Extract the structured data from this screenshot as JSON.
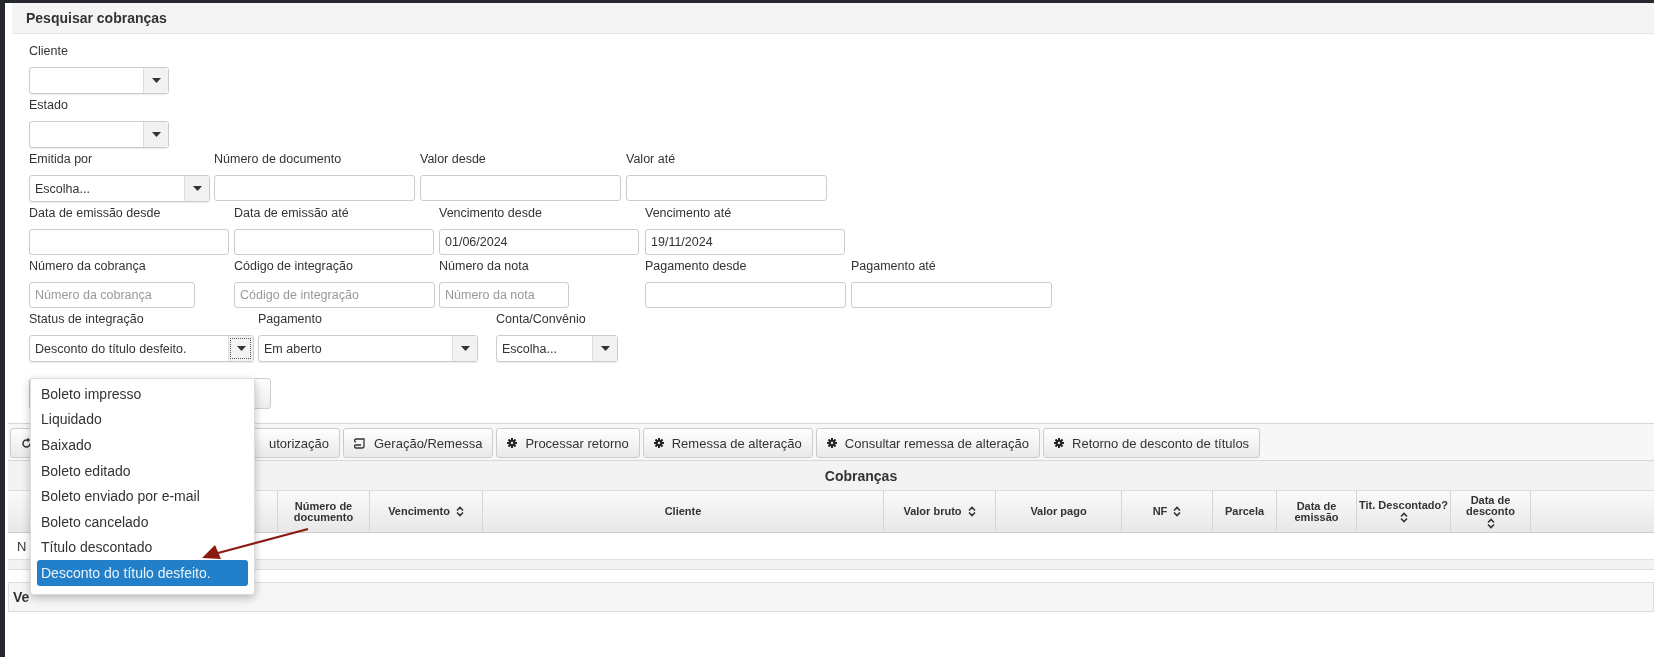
{
  "panel_title": "Pesquisar cobranças",
  "filter_rows": [
    [
      {
        "label": "Cliente",
        "kind": "select"
      }
    ],
    [
      {
        "label": "Estado",
        "kind": "select"
      }
    ],
    [
      {
        "label": "Emitida por",
        "kind": "select",
        "value": "Escolha..."
      },
      {
        "label": "Número de documento",
        "kind": "text"
      },
      {
        "label": "Valor desde",
        "kind": "text"
      },
      {
        "label": "Valor até",
        "kind": "text"
      }
    ],
    [
      {
        "label": "Data de emissão desde",
        "kind": "text"
      },
      {
        "label": "Data de emissão até",
        "kind": "text"
      },
      {
        "label": "Vencimento desde",
        "kind": "text",
        "value": "01/06/2024"
      },
      {
        "label": "Vencimento até",
        "kind": "text",
        "value": "19/11/2024"
      }
    ],
    [
      {
        "label": "Número da cobrança",
        "kind": "text",
        "placeholder": "Número da cobrança"
      },
      {
        "label": "Código de integração",
        "kind": "text",
        "placeholder": "Código de integração"
      },
      {
        "label": "Número da nota",
        "kind": "text",
        "placeholder": "Número da nota"
      },
      {
        "label": "Pagamento desde",
        "kind": "text"
      },
      {
        "label": "Pagamento até",
        "kind": "text"
      }
    ],
    [
      {
        "label": "Status de integração",
        "kind": "select",
        "value": "Desconto do título desfeito.",
        "open": true
      },
      {
        "label": "Pagamento",
        "kind": "select",
        "value": "Em aberto"
      },
      {
        "label": "Conta/Convênio",
        "kind": "select",
        "value": "Escolha..."
      }
    ]
  ],
  "status_options": [
    {
      "label": "Boleto impresso",
      "selected": false
    },
    {
      "label": "Liquidado",
      "selected": false
    },
    {
      "label": "Baixado",
      "selected": false
    },
    {
      "label": "Boleto editado",
      "selected": false
    },
    {
      "label": "Boleto enviado por e-mail",
      "selected": false
    },
    {
      "label": "Boleto cancelado",
      "selected": false
    },
    {
      "label": "Título descontado",
      "selected": false
    },
    {
      "label": "Desconto do título desfeito.",
      "selected": true
    }
  ],
  "toolbar": [
    {
      "label": "utorização",
      "kind": "refresh"
    },
    {
      "label": "Geração/Remessa",
      "kind": "scroll"
    },
    {
      "label": "Processar retorno",
      "kind": "gear"
    },
    {
      "label": "Remessa de alteração",
      "kind": "gear"
    },
    {
      "label": "Consultar remessa de alteração",
      "kind": "gear"
    },
    {
      "label": "Retorno de desconto de títulos",
      "kind": "gear"
    }
  ],
  "table": {
    "title": "Cobranças",
    "columns": [
      {},
      {},
      {
        "label": "Número de documento",
        "sortable": false
      },
      {
        "label": "Vencimento",
        "sortable": true
      },
      {
        "label": "Cliente",
        "sortable": false
      },
      {
        "label": "Valor bruto",
        "sortable": true
      },
      {
        "label": "Valor pago",
        "sortable": false
      },
      {
        "label": "NF",
        "sortable": true
      },
      {
        "label": "Parcela",
        "sortable": false
      },
      {
        "label": "Data de emissão",
        "sortable": false
      },
      {
        "label": "Tit. Descontado?",
        "sortable": true,
        "sort_below": true
      },
      {
        "label": "Data de desconto",
        "sortable": true,
        "sort_below": true
      },
      {
        "sortable": false
      }
    ],
    "rows": [
      {
        "cells": [
          "N"
        ]
      }
    ]
  },
  "bottom_panel_title": "Ve"
}
